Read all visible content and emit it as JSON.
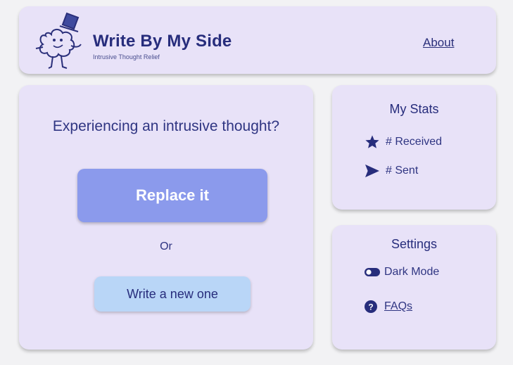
{
  "header": {
    "title": "Write By My Side",
    "subtitle": "Intrusive Thought Relief",
    "about_label": "About"
  },
  "main": {
    "prompt": "Experiencing an intrusive thought?",
    "replace_label": "Replace it",
    "or_label": "Or",
    "write_label": "Write a new one"
  },
  "stats": {
    "title": "My Stats",
    "items": [
      {
        "icon": "star-icon",
        "label": "# Received"
      },
      {
        "icon": "send-icon",
        "label": "# Sent"
      }
    ]
  },
  "settings": {
    "title": "Settings",
    "items": [
      {
        "icon": "toggle-icon",
        "label": "Dark Mode"
      },
      {
        "icon": "question-icon",
        "label": "FAQs"
      }
    ]
  },
  "colors": {
    "card": "#e8e2f8",
    "primary_button": "#8b9aec",
    "secondary_button": "#b9d6f7",
    "text": "#272d7c"
  }
}
